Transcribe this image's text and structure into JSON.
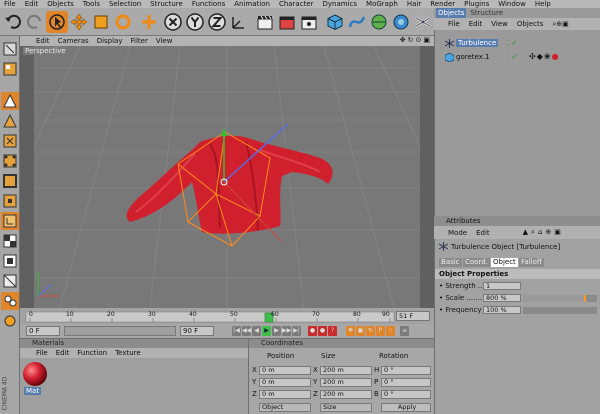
{
  "menubar": [
    "File",
    "Edit",
    "Objects",
    "Tools",
    "Selection",
    "Structure",
    "Functions",
    "Animation",
    "Character",
    "Dynamics",
    "MoGraph",
    "Hair",
    "Render",
    "Plugins",
    "Window",
    "Help"
  ],
  "viewport": {
    "menu": [
      "Edit",
      "Cameras",
      "Display",
      "Filter",
      "View"
    ],
    "label": "Perspective"
  },
  "timeline": {
    "ticks": [
      "0",
      "10",
      "20",
      "30",
      "40",
      "50",
      "60",
      "70",
      "80",
      "90"
    ],
    "current_marker": "51 F",
    "start_field": "0 F",
    "end_field": "90 F"
  },
  "materials": {
    "title": "Materials",
    "menu": [
      "File",
      "Edit",
      "Function",
      "Texture"
    ],
    "items": [
      {
        "name": "Mat",
        "color": "#d0202d"
      }
    ]
  },
  "coordinates": {
    "title": "Coordinates",
    "headers": [
      "Position",
      "Size",
      "Rotation"
    ],
    "rows": [
      {
        "axis": "X",
        "pos": "0 m",
        "size_axis": "X",
        "size": "200 m",
        "rot_axis": "H",
        "rot": "0 °"
      },
      {
        "axis": "Y",
        "pos": "0 m",
        "size_axis": "Y",
        "size": "200 m",
        "rot_axis": "P",
        "rot": "0 °"
      },
      {
        "axis": "Z",
        "pos": "0 m",
        "size_axis": "Z",
        "size": "200 m",
        "rot_axis": "B",
        "rot": "0 °"
      }
    ],
    "mode_select": "Object",
    "size_select": "Size",
    "apply_label": "Apply"
  },
  "objects": {
    "tabs": [
      "Objects",
      "Structure"
    ],
    "menu": [
      "File",
      "Edit",
      "View",
      "Objects"
    ],
    "items": [
      {
        "name": "Turbulence",
        "selected": true
      },
      {
        "name": "goretex.1",
        "selected": false
      }
    ]
  },
  "attributes": {
    "title": "Attributes",
    "menu": [
      "Mode",
      "Edit"
    ],
    "object_title": "Turbulence Object [Turbulence]",
    "tabs": [
      "Basic",
      "Coord.",
      "Object",
      "Falloff"
    ],
    "active_tab": "Object",
    "section": "Object Properties",
    "properties": [
      {
        "label": "Strength",
        "value": "1",
        "fill": 0
      },
      {
        "label": "Scale",
        "value": "800 %",
        "fill": 0.85
      },
      {
        "label": "Frequency",
        "value": "100 %",
        "fill": 0
      }
    ]
  },
  "colors": {
    "accent": "#ff7a00",
    "cloth": "#d0202d",
    "selection": "#5a7db0"
  },
  "side_label": "CINEMA 4D"
}
